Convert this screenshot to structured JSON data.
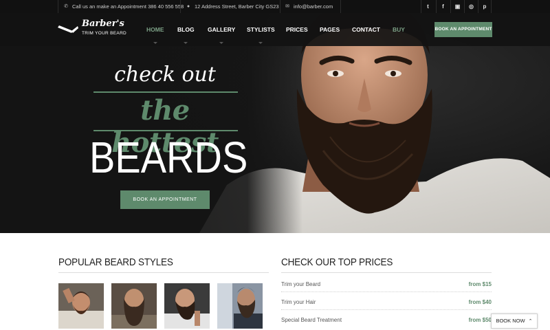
{
  "topbar": {
    "phone_text": "Call us an make an Appointment 386 40 556 558",
    "address_text": "12 Address Street, Barber City GS23",
    "email_text": "info@barber.com",
    "icons": [
      "phone-icon",
      "location-pin-icon",
      "envelope-icon"
    ],
    "social": [
      "twitter",
      "facebook",
      "instagram",
      "dribbble",
      "pinterest"
    ]
  },
  "logo": {
    "name": "Barber's",
    "tagline": "TRIM YOUR BEARD"
  },
  "nav": {
    "items": [
      {
        "label": "HOME",
        "active": true
      },
      {
        "label": "BLOG"
      },
      {
        "label": "GALLERY"
      },
      {
        "label": "STYLISTS"
      },
      {
        "label": "PRICES"
      },
      {
        "label": "PAGES"
      },
      {
        "label": "CONTACT"
      },
      {
        "label": "BUY"
      }
    ],
    "cta": "BOOK AN APPOINTMENT"
  },
  "hero": {
    "line1": "check out",
    "line2": "the hottest",
    "line3": "BEARDS",
    "button": "BOOK AN APPOINTMENT"
  },
  "styles_section": {
    "title": "POPULAR BEARD STYLES"
  },
  "prices_section": {
    "title": "CHECK OUR TOP PRICES",
    "rows": [
      {
        "name": "Trim your Beard",
        "price": "from $15"
      },
      {
        "name": "Trim your Hair",
        "price": "from $40"
      },
      {
        "name": "Special Beard Treatment",
        "price": "from $50"
      }
    ]
  },
  "book_now": {
    "label": "BOOK NOW",
    "icon": "chevron-up-icon"
  },
  "colors": {
    "accent": "#5e8a6c",
    "topbar": "#111111",
    "nav": "#121212"
  }
}
